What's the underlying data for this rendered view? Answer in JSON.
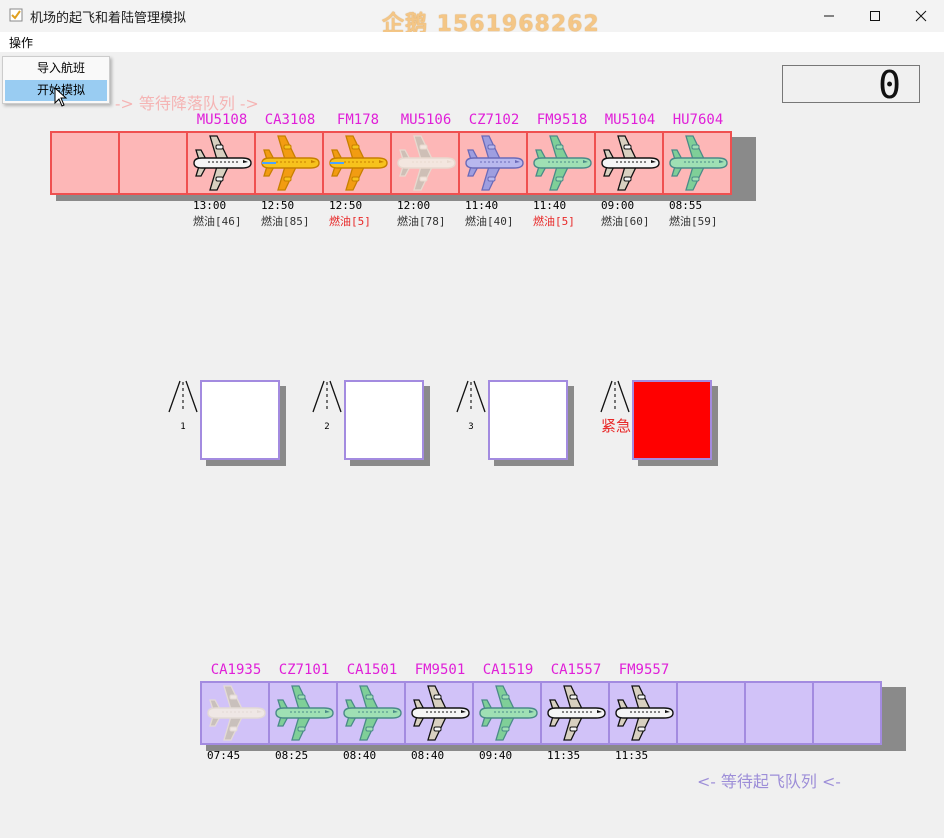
{
  "window": {
    "title": "机场的起飞和着陆管理模拟",
    "watermark": "企鹅 1561968262",
    "controls": [
      "minimize-icon",
      "maximize-icon",
      "close-icon"
    ]
  },
  "menu": {
    "label": "操作",
    "items": [
      "导入航班",
      "开始模拟"
    ],
    "highlighted": "开始模拟"
  },
  "counter": {
    "value": "0"
  },
  "landing_queue": {
    "label": "-> 等待降落队列 ->",
    "slots": [
      null,
      null,
      {
        "flight": "MU5108",
        "time": "13:00",
        "fuel": "燃油[46]",
        "low": false,
        "icon": "airliner-white-icon"
      },
      {
        "flight": "CA3108",
        "time": "12:50",
        "fuel": "燃油[85]",
        "low": false,
        "icon": "airliner-yellow-icon"
      },
      {
        "flight": "FM178",
        "time": "12:50",
        "fuel": "燃油[5]",
        "low": true,
        "icon": "airliner-yellow-icon"
      },
      {
        "flight": "MU5106",
        "time": "12:00",
        "fuel": "燃油[78]",
        "low": false,
        "icon": "airliner-faded-icon"
      },
      {
        "flight": "CZ7102",
        "time": "11:40",
        "fuel": "燃油[40]",
        "low": false,
        "icon": "airliner-lavender-icon"
      },
      {
        "flight": "FM9518",
        "time": "11:40",
        "fuel": "燃油[5]",
        "low": true,
        "icon": "airliner-green-icon"
      },
      {
        "flight": "MU5104",
        "time": "09:00",
        "fuel": "燃油[60]",
        "low": false,
        "icon": "airliner-white-icon"
      },
      {
        "flight": "HU7604",
        "time": "08:55",
        "fuel": "燃油[59]",
        "low": false,
        "icon": "airliner-green-icon"
      }
    ]
  },
  "runways": [
    {
      "number": "1",
      "emergency": false
    },
    {
      "number": "2",
      "emergency": false
    },
    {
      "number": "3",
      "emergency": false
    },
    {
      "number": "紧急",
      "emergency": true
    }
  ],
  "takeoff_queue": {
    "label": "<- 等待起飞队列 <-",
    "slots": [
      {
        "flight": "CA1935",
        "time": "07:45",
        "icon": "airliner-faded-icon"
      },
      {
        "flight": "CZ7101",
        "time": "08:25",
        "icon": "airliner-green-icon"
      },
      {
        "flight": "CA1501",
        "time": "08:40",
        "icon": "airliner-green-icon"
      },
      {
        "flight": "FM9501",
        "time": "08:40",
        "icon": "airliner-white-icon"
      },
      {
        "flight": "CA1519",
        "time": "09:40",
        "icon": "airliner-green-icon"
      },
      {
        "flight": "CA1557",
        "time": "11:35",
        "icon": "airliner-white-icon"
      },
      {
        "flight": "FM9557",
        "time": "11:35",
        "icon": "airliner-white-icon"
      },
      null,
      null,
      null
    ]
  },
  "colors": {
    "landing_cell": "#fdb7b7",
    "landing_border": "#ef5050",
    "takeoff_cell": "#d1c2f8",
    "takeoff_border": "#a38be0",
    "flight_label": "#e020d8",
    "low_fuel": "#e82828",
    "emergency_runway": "#ff0000"
  }
}
